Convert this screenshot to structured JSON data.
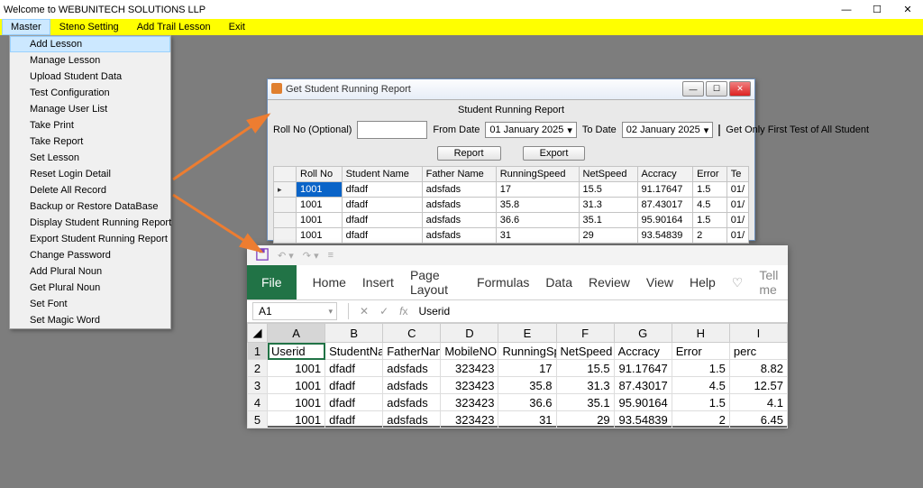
{
  "window": {
    "title": "Welcome to WEBUNITECH SOLUTIONS LLP"
  },
  "menubar": [
    "Master",
    "Steno Setting",
    "Add Trail Lesson",
    "Exit"
  ],
  "dropdown": [
    "Add Lesson",
    "Manage Lesson",
    "Upload Student Data",
    "Test Configuration",
    "Manage User List",
    "Take Print",
    "Take Report",
    "Set Lesson",
    "Reset Login Detail",
    "Delete All Record",
    "Backup or Restore DataBase",
    "Display Student Running Report",
    "Export Student Running Report",
    "Change Password",
    "Add Plural Noun",
    "Get Plural Noun",
    "Set Font",
    "Set Magic Word"
  ],
  "report": {
    "winTitle": "Get Student Running Report",
    "heading": "Student Running Report",
    "rollLabel": "Roll No (Optional)",
    "fromLabel": "From Date",
    "fromDate": "01  January   2025",
    "toLabel": "To Date",
    "toDate": "02  January   2025",
    "checkLabel": "Get Only First Test of All Student",
    "reportBtn": "Report",
    "exportBtn": "Export",
    "columns": [
      "Roll No",
      "Student Name",
      "Father Name",
      "RunningSpeed",
      "NetSpeed",
      "Accracy",
      "Error",
      "Te"
    ],
    "rows": [
      {
        "roll": "1001",
        "student": "dfadf",
        "father": "adsfads",
        "rs": "17",
        "ns": "15.5",
        "acc": "91.17647",
        "err": "1.5",
        "te": "01/"
      },
      {
        "roll": "1001",
        "student": "dfadf",
        "father": "adsfads",
        "rs": "35.8",
        "ns": "31.3",
        "acc": "87.43017",
        "err": "4.5",
        "te": "01/"
      },
      {
        "roll": "1001",
        "student": "dfadf",
        "father": "adsfads",
        "rs": "36.6",
        "ns": "35.1",
        "acc": "95.90164",
        "err": "1.5",
        "te": "01/"
      },
      {
        "roll": "1001",
        "student": "dfadf",
        "father": "adsfads",
        "rs": "31",
        "ns": "29",
        "acc": "93.54839",
        "err": "2",
        "te": "01/"
      }
    ]
  },
  "excel": {
    "tabs": [
      "File",
      "Home",
      "Insert",
      "Page Layout",
      "Formulas",
      "Data",
      "Review",
      "View",
      "Help"
    ],
    "tellme": "Tell me",
    "nameBox": "A1",
    "fxContent": "Userid",
    "colHeaders": [
      "A",
      "B",
      "C",
      "D",
      "E",
      "F",
      "G",
      "H",
      "I"
    ],
    "rowHeaders": [
      "1",
      "2",
      "3",
      "4",
      "5"
    ],
    "header": [
      "Userid",
      "StudentNa",
      "FatherNam",
      "MobileNO",
      "RunningSp",
      "NetSpeed",
      "Accracy",
      "Error",
      "perc"
    ],
    "rows": [
      [
        "1001",
        "dfadf",
        "adsfads",
        "323423",
        "17",
        "15.5",
        "91.17647",
        "1.5",
        "8.82"
      ],
      [
        "1001",
        "dfadf",
        "adsfads",
        "323423",
        "35.8",
        "31.3",
        "87.43017",
        "4.5",
        "12.57"
      ],
      [
        "1001",
        "dfadf",
        "adsfads",
        "323423",
        "36.6",
        "35.1",
        "95.90164",
        "1.5",
        "4.1"
      ],
      [
        "1001",
        "dfadf",
        "adsfads",
        "323423",
        "31",
        "29",
        "93.54839",
        "2",
        "6.45"
      ]
    ]
  },
  "chart_data": {
    "type": "table",
    "title": "Student Running Report",
    "columns": [
      "Userid",
      "StudentName",
      "FatherName",
      "MobileNO",
      "RunningSpeed",
      "NetSpeed",
      "Accracy",
      "Error",
      "perc"
    ],
    "rows": [
      [
        1001,
        "dfadf",
        "adsfads",
        323423,
        17,
        15.5,
        91.17647,
        1.5,
        8.82
      ],
      [
        1001,
        "dfadf",
        "adsfads",
        323423,
        35.8,
        31.3,
        87.43017,
        4.5,
        12.57
      ],
      [
        1001,
        "dfadf",
        "adsfads",
        323423,
        36.6,
        35.1,
        95.90164,
        1.5,
        4.1
      ],
      [
        1001,
        "dfadf",
        "adsfads",
        323423,
        31,
        29,
        93.54839,
        2,
        6.45
      ]
    ]
  }
}
